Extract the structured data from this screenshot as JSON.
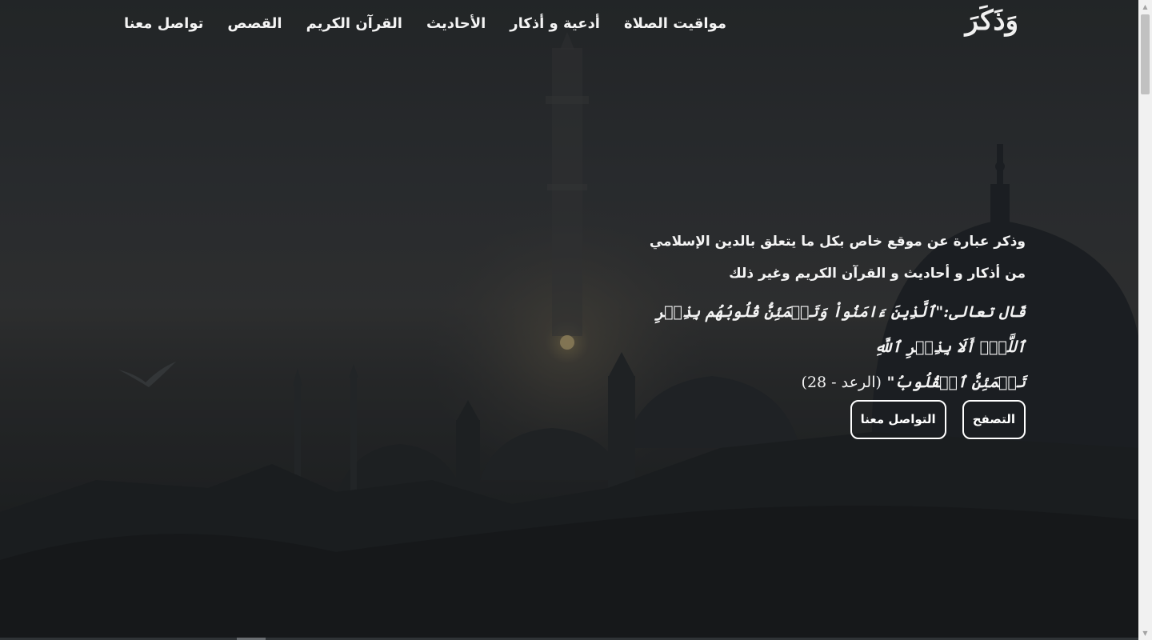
{
  "brand": {
    "logo_text": "وَذَكَرَ"
  },
  "nav": {
    "items": [
      {
        "label": "مواقيت الصلاة"
      },
      {
        "label": "أدعية و أذكار"
      },
      {
        "label": "الأحاديث"
      },
      {
        "label": "القرآن الكريم"
      },
      {
        "label": "القصص"
      },
      {
        "label": "تواصل معنا"
      }
    ]
  },
  "hero": {
    "line1": "وذكر عبارة عن موقع خاص بكل ما يتعلق بالدين الإسلامي",
    "line2": "من أذكار و أحاديث و القرآن الكريم وغير ذلك",
    "verse_line1": "قَال تعالى:\"ٱلَّذِينَ ءَامَنُواْ وَتَطۡمَئِنُّ قُلُوبُهُم بِذِكۡرِ ٱللَّهِۗ أَلَا بِذِكۡرِ ٱللَّهِ",
    "verse_line2": "تَطۡمَئِنُّ ٱلۡقُلُوبُ\"",
    "verse_ref": "(الرعد - 28)",
    "browse_button": "التصفح",
    "contact_button": "التواصل معنا"
  },
  "colors": {
    "text": "#f4f4f4",
    "button_border": "#ffffff",
    "background_dark": "#1c2024"
  }
}
